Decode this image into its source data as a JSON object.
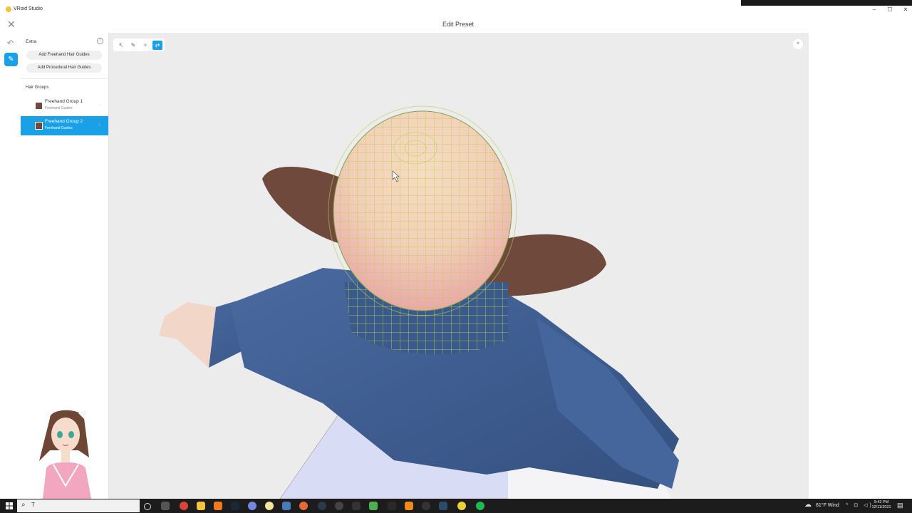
{
  "window": {
    "app_title": "VRoid Studio",
    "controls": [
      "–",
      "☐",
      "✕"
    ]
  },
  "header": {
    "title": "Edit Preset",
    "close": "✕"
  },
  "rail": {
    "undo_icon": "↶",
    "hair_icon": "✎"
  },
  "panel": {
    "extra_label": "Extra",
    "help": "?",
    "add_freehand": "Add Freehand Hair Guides",
    "add_procedural": "Add Procedural Hair Guides",
    "hair_groups_label": "Hair Groups",
    "groups": [
      {
        "name": "Freehand Group 1",
        "sub": "Freehand Guides",
        "color": "#704a3c"
      },
      {
        "name": "Freehand Group 2",
        "sub": "Freehand Guides",
        "color": "#704a3c"
      }
    ]
  },
  "toolbar": {
    "tools": [
      "↖",
      "✎",
      "✧",
      "⇄"
    ]
  },
  "viewport": {
    "view_toggle": "⚭"
  },
  "taskbar": {
    "search_icon": "⌕",
    "search_text": "T",
    "weather": "61°F  Wind",
    "time": "9:42 PM",
    "date": "12/11/2021",
    "tray": "^ ⊡ ◁)"
  },
  "colors": {
    "accent": "#1aa0e6",
    "hair": "#704a3c",
    "shirt": "#3f5e92",
    "mesh": "#bcd25a"
  }
}
